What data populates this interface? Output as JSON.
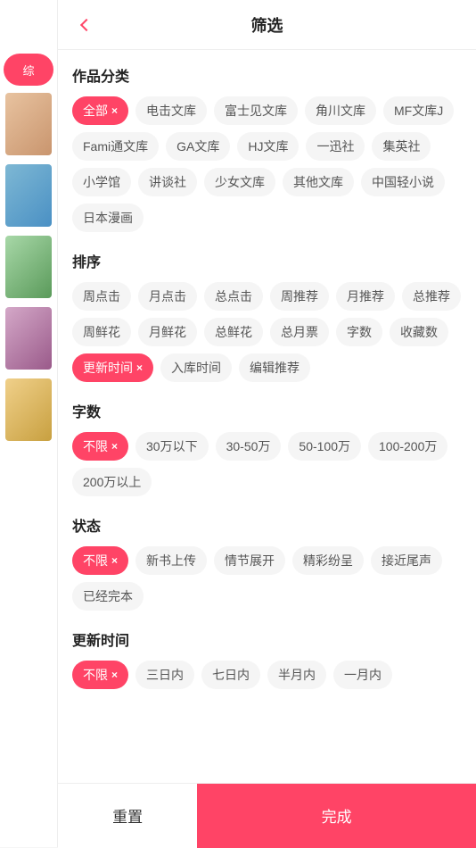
{
  "sidebar": {
    "active_tab": "综",
    "tabs": [
      {
        "label": "综",
        "active": true
      }
    ]
  },
  "panel": {
    "title": "筛选",
    "back_label": "back"
  },
  "sections": [
    {
      "id": "category",
      "title": "作品分类",
      "tags": [
        {
          "label": "全部",
          "active": true,
          "closable": true
        },
        {
          "label": "电击文库",
          "active": false
        },
        {
          "label": "富士见文库",
          "active": false
        },
        {
          "label": "角川文库",
          "active": false
        },
        {
          "label": "MF文库J",
          "active": false
        },
        {
          "label": "Fami通文库",
          "active": false
        },
        {
          "label": "GA文库",
          "active": false
        },
        {
          "label": "HJ文库",
          "active": false
        },
        {
          "label": "一迅社",
          "active": false
        },
        {
          "label": "集英社",
          "active": false
        },
        {
          "label": "小学馆",
          "active": false
        },
        {
          "label": "讲谈社",
          "active": false
        },
        {
          "label": "少女文库",
          "active": false
        },
        {
          "label": "其他文库",
          "active": false
        },
        {
          "label": "中国轻小说",
          "active": false
        },
        {
          "label": "日本漫画",
          "active": false
        }
      ]
    },
    {
      "id": "sort",
      "title": "排序",
      "tags": [
        {
          "label": "周点击",
          "active": false
        },
        {
          "label": "月点击",
          "active": false
        },
        {
          "label": "总点击",
          "active": false
        },
        {
          "label": "周推荐",
          "active": false
        },
        {
          "label": "月推荐",
          "active": false
        },
        {
          "label": "总推荐",
          "active": false
        },
        {
          "label": "周鲜花",
          "active": false
        },
        {
          "label": "月鲜花",
          "active": false
        },
        {
          "label": "总鲜花",
          "active": false
        },
        {
          "label": "总月票",
          "active": false
        },
        {
          "label": "字数",
          "active": false
        },
        {
          "label": "收藏数",
          "active": false
        },
        {
          "label": "更新时间",
          "active": true,
          "closable": true
        },
        {
          "label": "入库时间",
          "active": false
        },
        {
          "label": "编辑推荐",
          "active": false
        }
      ]
    },
    {
      "id": "wordcount",
      "title": "字数",
      "tags": [
        {
          "label": "不限",
          "active": true,
          "closable": true
        },
        {
          "label": "30万以下",
          "active": false
        },
        {
          "label": "30-50万",
          "active": false
        },
        {
          "label": "50-100万",
          "active": false
        },
        {
          "label": "100-200万",
          "active": false
        },
        {
          "label": "200万以上",
          "active": false
        }
      ]
    },
    {
      "id": "status",
      "title": "状态",
      "tags": [
        {
          "label": "不限",
          "active": true,
          "closable": true
        },
        {
          "label": "新书上传",
          "active": false
        },
        {
          "label": "情节展开",
          "active": false
        },
        {
          "label": "精彩纷呈",
          "active": false
        },
        {
          "label": "接近尾声",
          "active": false
        },
        {
          "label": "已经完本",
          "active": false
        }
      ]
    },
    {
      "id": "update_time",
      "title": "更新时间",
      "tags": [
        {
          "label": "不限",
          "active": true,
          "closable": true
        },
        {
          "label": "三日内",
          "active": false
        },
        {
          "label": "七日内",
          "active": false
        },
        {
          "label": "半月内",
          "active": false
        },
        {
          "label": "一月内",
          "active": false
        }
      ]
    }
  ],
  "footer": {
    "reset_label": "重置",
    "confirm_label": "完成"
  }
}
